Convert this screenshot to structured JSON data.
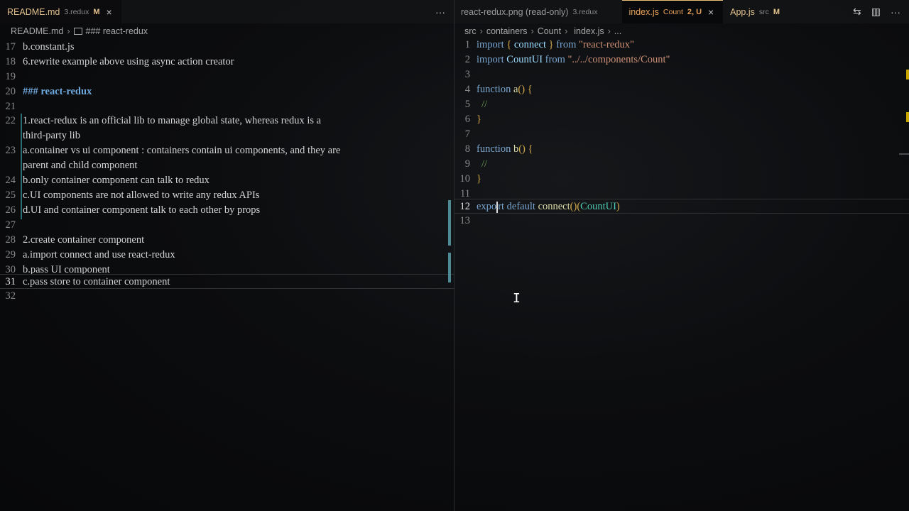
{
  "left": {
    "tabs": [
      {
        "title": "README.md",
        "desc": "3.redux",
        "mod": "M",
        "close": "×"
      }
    ],
    "more": "···",
    "breadcrumb": [
      "README.md",
      "### react-redux"
    ],
    "lines": [
      {
        "n": "17",
        "text": "b.constant.js"
      },
      {
        "n": "18",
        "text": "6.rewrite example above using async action creator"
      },
      {
        "n": "19",
        "text": ""
      },
      {
        "n": "20",
        "text": "### react-redux"
      },
      {
        "n": "21",
        "text": ""
      },
      {
        "n": "22",
        "text": "1.react-redux is an official lib to manage global state, whereas redux is a",
        "wrap": "third-party lib"
      },
      {
        "n": "23",
        "text": "a.container vs ui component : containers contain ui components, and they are",
        "wrap": "parent and child component"
      },
      {
        "n": "24",
        "text": "b.only container component can talk to redux"
      },
      {
        "n": "25",
        "text": "c.UI components are not allowed to write any redux APIs"
      },
      {
        "n": "26",
        "text": "d.UI and container component talk to each other by props"
      },
      {
        "n": "27",
        "text": ""
      },
      {
        "n": "28",
        "text": "2.create container component"
      },
      {
        "n": "29",
        "text": "a.import connect and use react-redux"
      },
      {
        "n": "30",
        "text": "b.pass UI component"
      },
      {
        "n": "31",
        "text": "c.pass store to container component"
      },
      {
        "n": "32",
        "text": ""
      }
    ]
  },
  "right": {
    "tabs": [
      {
        "title": "react-redux.png (read-only)",
        "desc": "3.redux"
      },
      {
        "title": "index.js",
        "desc": "Count",
        "mod": "2, U",
        "close": "×"
      },
      {
        "title": "App.js",
        "desc": "src",
        "mod": "M"
      }
    ],
    "actions": [
      "⇆",
      "▥",
      "···"
    ],
    "breadcrumb": [
      "src",
      "containers",
      "Count",
      "index.js",
      "..."
    ],
    "line_numbers": [
      "1",
      "2",
      "3",
      "4",
      "5",
      "6",
      "7",
      "8",
      "9",
      "10",
      "11",
      "12",
      "13"
    ],
    "code": {
      "l1": {
        "a": "import",
        "b": "{",
        "c": "connect",
        "d": "}",
        "e": "from",
        "f": "\"react-redux\""
      },
      "l2": {
        "a": "import",
        "b": "CountUI",
        "c": "from",
        "d": "\"../../components/Count\""
      },
      "l4": {
        "a": "function",
        "b": "a",
        "c": "()",
        "d": "{"
      },
      "l5": {
        "a": "//"
      },
      "l6": {
        "a": "}"
      },
      "l8": {
        "a": "function",
        "b": "b",
        "c": "()",
        "d": "{"
      },
      "l9": {
        "a": "//"
      },
      "l10": {
        "a": "}"
      },
      "l12": {
        "a": "expo",
        "b": "rt",
        "c": "default",
        "d": "connect",
        "e": "()",
        "f": "(",
        "g": "CountUI",
        "h": ")"
      }
    }
  },
  "colors": {
    "accent_mod": "#e2c08d",
    "tab_orange": "#e9a15a",
    "gutter_bar": "#2b6b76",
    "scroll_marker": "#c9a500"
  }
}
